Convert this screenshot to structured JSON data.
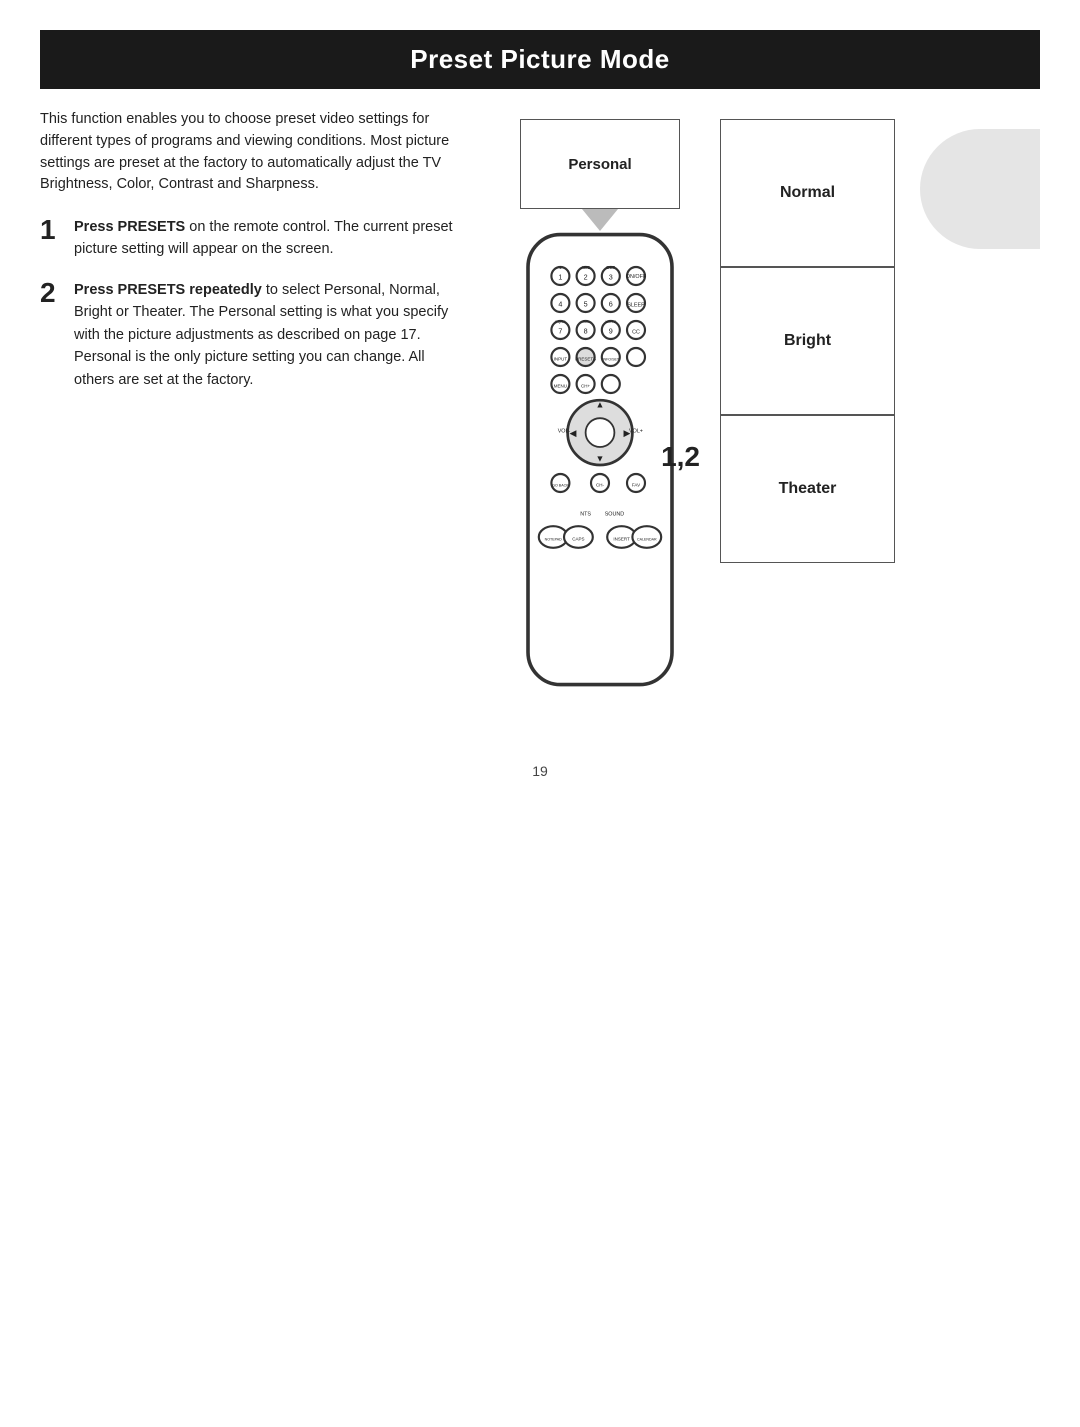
{
  "page": {
    "title": "Preset Picture Mode",
    "page_number": "19"
  },
  "intro": {
    "text": "This function enables you to choose preset video settings for different types of programs and viewing conditions. Most picture settings are preset at the factory to automatically adjust the TV Brightness, Color, Contrast and Sharpness."
  },
  "steps": [
    {
      "number": "1",
      "bold_part": "Press PRESETS",
      "text_after": " on the remote control. The current preset picture setting will appear on the screen."
    },
    {
      "number": "2",
      "bold_part": "Press PRESETS repeatedly",
      "text_after": " to select Personal, Normal, Bright or Theater. The Personal setting is what you specify with the picture adjustments as described on page 17. Personal is the only picture setting you can change. All others are set at the factory."
    }
  ],
  "preset_labels": {
    "personal": "Personal",
    "normal": "Normal",
    "bright": "Bright",
    "theater": "Theater"
  },
  "number_label": "1,2"
}
